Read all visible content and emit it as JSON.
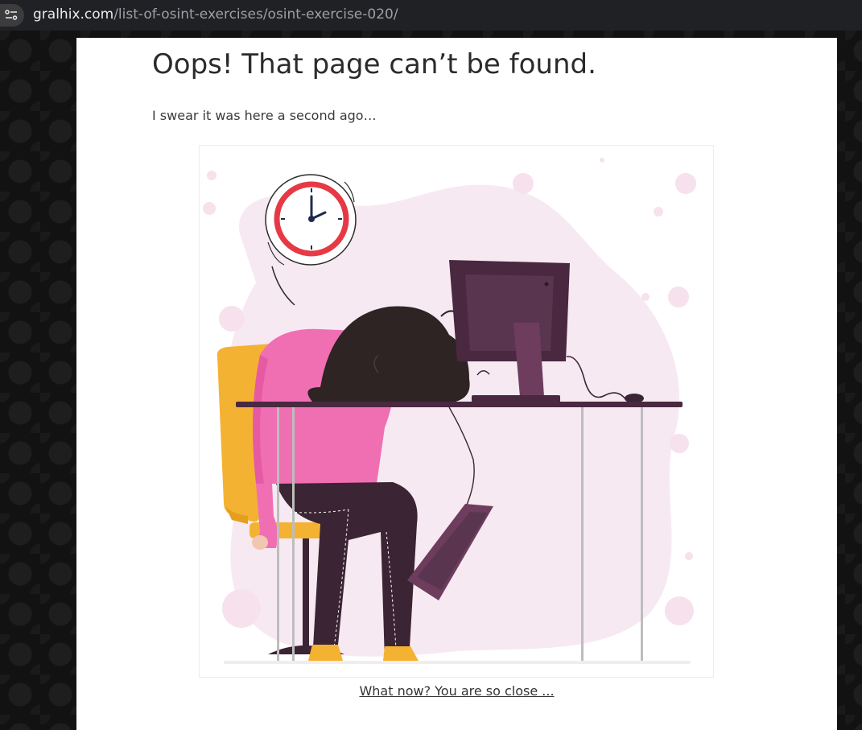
{
  "browser": {
    "url_host": "gralhix.com",
    "url_path": "/list-of-osint-exercises/osint-exercise-020/",
    "site_info_icon": "tune-icon"
  },
  "page": {
    "title": "Oops! That page can’t be found.",
    "subtitle": "I swear it was here a second ago…",
    "illustration": "person-asleep-at-desk-illustration",
    "link_text": "What now? You are so close ..."
  },
  "colors": {
    "page_background": "#111111",
    "content_background": "#ffffff",
    "blob": "#f7e9f2",
    "clock_ring": "#e63946",
    "monitor": "#4a2840",
    "sweater": "#f06fb3",
    "hair": "#2e2424",
    "chair": "#f4b233",
    "pants": "#3b2433"
  }
}
